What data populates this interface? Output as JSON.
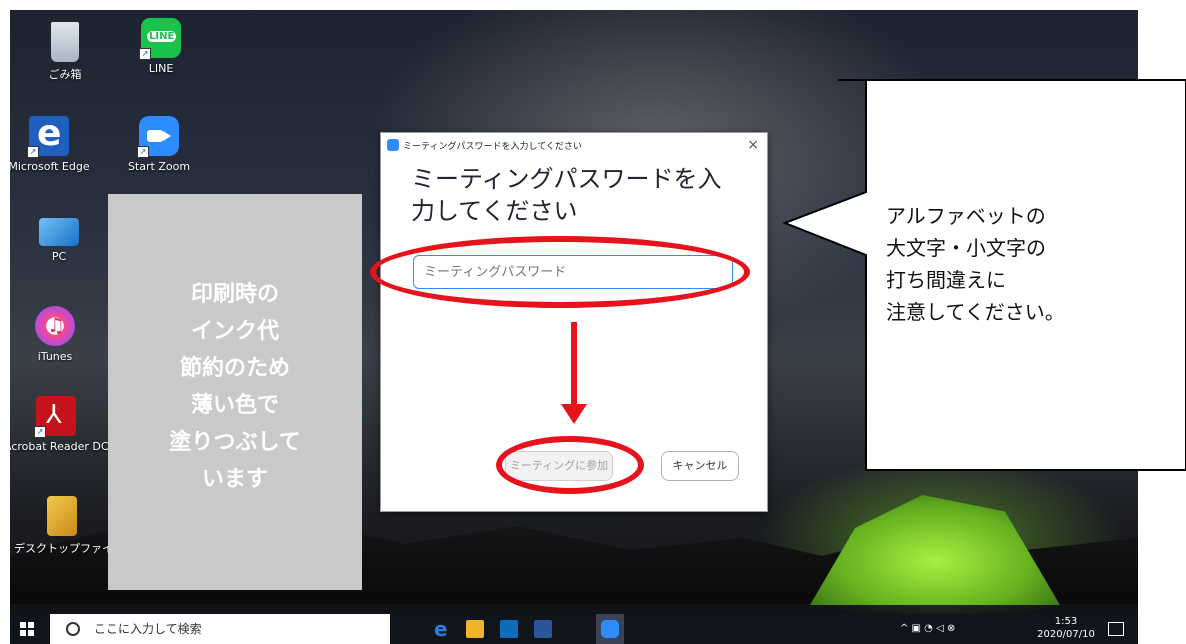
{
  "desktop": {
    "icons": [
      {
        "label": "ごみ箱",
        "icon": "recycle-bin-icon"
      },
      {
        "label": "LINE",
        "icon": "line-app-icon",
        "badge": "LINE"
      },
      {
        "label": "Microsoft Edge",
        "icon": "edge-icon"
      },
      {
        "label": "Start Zoom",
        "icon": "zoom-icon"
      },
      {
        "label": "PC",
        "icon": "pc-icon"
      },
      {
        "label": "iTunes",
        "icon": "itunes-icon"
      },
      {
        "label": "Acrobat Reader DC",
        "icon": "acrobat-icon"
      },
      {
        "label": "デスクトップファイル",
        "icon": "folder-icon"
      }
    ]
  },
  "overlay_note": "印刷時の\nインク代\n節約のため\n薄い色で\n塗りつぶして\nいます",
  "dialog": {
    "title": "ミーティングパスワードを入力してください",
    "heading": "ミーティングパスワードを入力してください",
    "password_placeholder": "ミーティングパスワード",
    "password_value": "",
    "join_label": "ミーティングに参加",
    "cancel_label": "キャンセル",
    "close_glyph": "×"
  },
  "callout_text": "アルファベットの\n大文字・小文字の\n打ち間違えに\n注意してください。",
  "taskbar": {
    "search_placeholder": "ここに入力して検索",
    "time": "1:53",
    "date": "2020/07/10",
    "apps": [
      "edge-icon",
      "file-explorer-icon",
      "mail-icon",
      "word-icon",
      "zoom-icon"
    ]
  },
  "colors": {
    "annotation_red": "#e6121c",
    "zoom_blue": "#2d8cff",
    "taskbar": "#10141b"
  }
}
